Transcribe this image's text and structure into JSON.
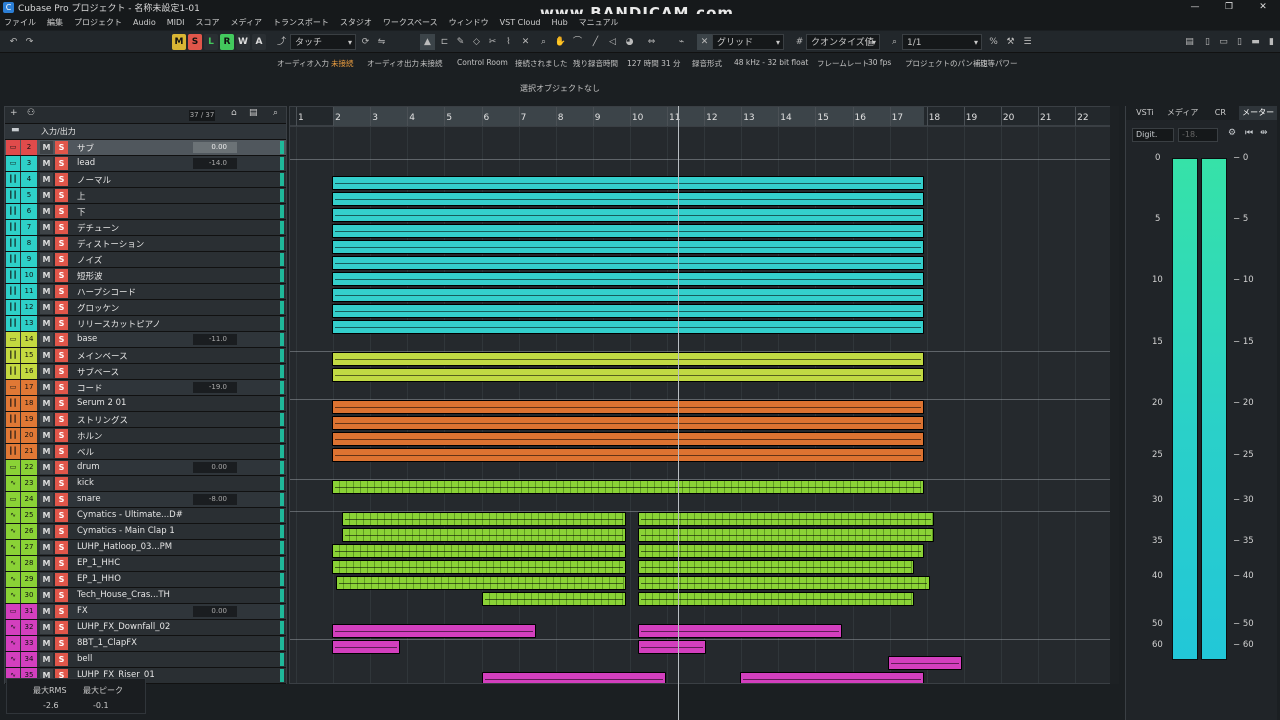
{
  "window": {
    "title": "Cubase Pro プロジェクト - 名称未設定1-01",
    "watermark": "www.BANDICAM.com",
    "controls": [
      "—",
      "❐",
      "✕"
    ]
  },
  "menu": [
    "ファイル",
    "編集",
    "プロジェクト",
    "Audio",
    "MIDI",
    "スコア",
    "メディア",
    "トランスポート",
    "スタジオ",
    "ワークスペース",
    "ウィンドウ",
    "VST Cloud",
    "Hub",
    "マニュアル"
  ],
  "toolbar": {
    "buttons": [
      "M",
      "S",
      "L",
      "R",
      "W",
      "A"
    ],
    "automation": "タッチ",
    "snap": "グリッド",
    "quantize": "クオンタイズ値",
    "grid": "1/1"
  },
  "status": {
    "input_label": "オーディオ入力",
    "input_value": "未接続",
    "output_label": "オーディオ出力",
    "output_value": "未接続",
    "control_room": "Control Room",
    "control_room_value": "接続されました",
    "rec_time_label": "残り録音時間",
    "rec_time_value": "127 時間 31 分",
    "rec_format_label": "録音形式",
    "rec_format_value": "48 kHz - 32 bit float",
    "frame_label": "フレームレート",
    "frame_value": "30 fps",
    "pan_label": "プロジェクトのパン補正",
    "pan_value": "均等パワー"
  },
  "info_line": "選択オブジェクトなし",
  "track_header": {
    "count": "37 / 37",
    "io_label": "入力/出力"
  },
  "ruler": [
    "1",
    "2",
    "3",
    "4",
    "5",
    "6",
    "7",
    "8",
    "9",
    "10",
    "11",
    "12",
    "13",
    "14",
    "15",
    "16",
    "17",
    "18",
    "19",
    "20",
    "21",
    "22"
  ],
  "tracks": [
    {
      "num": "2",
      "name": "サブ",
      "vol": "0.00",
      "type": "folder",
      "color": "#e04b4b",
      "icon": "folder-icon"
    },
    {
      "num": "3",
      "name": "lead",
      "vol": "-14.0",
      "type": "folder",
      "color": "#2ed0c8",
      "icon": "folder-icon"
    },
    {
      "num": "4",
      "name": "ノーマル",
      "vol": "",
      "type": "inst",
      "color": "#2ed0c8",
      "icon": "instrument-icon"
    },
    {
      "num": "5",
      "name": "上",
      "vol": "",
      "type": "inst",
      "color": "#2ed0c8",
      "icon": "instrument-icon"
    },
    {
      "num": "6",
      "name": "下",
      "vol": "",
      "type": "inst",
      "color": "#2ed0c8",
      "icon": "instrument-icon"
    },
    {
      "num": "7",
      "name": "デチューン",
      "vol": "",
      "type": "inst",
      "color": "#2ed0c8",
      "icon": "instrument-icon"
    },
    {
      "num": "8",
      "name": "ディストーション",
      "vol": "",
      "type": "inst",
      "color": "#2ed0c8",
      "icon": "instrument-icon"
    },
    {
      "num": "9",
      "name": "ノイズ",
      "vol": "",
      "type": "inst",
      "color": "#2ed0c8",
      "icon": "instrument-icon"
    },
    {
      "num": "10",
      "name": "短形波",
      "vol": "",
      "type": "inst",
      "color": "#2ed0c8",
      "icon": "instrument-icon"
    },
    {
      "num": "11",
      "name": "ハープシコード",
      "vol": "",
      "type": "inst",
      "color": "#2ed0c8",
      "icon": "instrument-icon"
    },
    {
      "num": "12",
      "name": "グロッケン",
      "vol": "",
      "type": "inst",
      "color": "#2ed0c8",
      "icon": "instrument-icon"
    },
    {
      "num": "13",
      "name": "リリースカットピアノ",
      "vol": "",
      "type": "inst",
      "color": "#2ed0c8",
      "icon": "instrument-icon"
    },
    {
      "num": "14",
      "name": "base",
      "vol": "-11.0",
      "type": "folder",
      "color": "#c4d940",
      "icon": "folder-icon"
    },
    {
      "num": "15",
      "name": "メインベース",
      "vol": "",
      "type": "inst",
      "color": "#c4d940",
      "icon": "instrument-icon"
    },
    {
      "num": "16",
      "name": "サブベース",
      "vol": "",
      "type": "inst",
      "color": "#c4d940",
      "icon": "instrument-icon"
    },
    {
      "num": "17",
      "name": "コード",
      "vol": "-19.0",
      "type": "folder",
      "color": "#e07835",
      "icon": "folder-icon"
    },
    {
      "num": "18",
      "name": "Serum 2 01",
      "vol": "",
      "type": "inst",
      "color": "#e07835",
      "icon": "instrument-icon"
    },
    {
      "num": "19",
      "name": "ストリングス",
      "vol": "",
      "type": "inst",
      "color": "#e07835",
      "icon": "instrument-icon"
    },
    {
      "num": "20",
      "name": "ホルン",
      "vol": "",
      "type": "inst",
      "color": "#e07835",
      "icon": "instrument-icon"
    },
    {
      "num": "21",
      "name": "ベル",
      "vol": "",
      "type": "inst",
      "color": "#e07835",
      "icon": "instrument-icon"
    },
    {
      "num": "22",
      "name": "drum",
      "vol": "0.00",
      "type": "folder",
      "color": "#8ad236",
      "icon": "folder-icon"
    },
    {
      "num": "23",
      "name": "kick",
      "vol": "",
      "type": "audio",
      "color": "#8ad236",
      "icon": "audio-icon"
    },
    {
      "num": "24",
      "name": "snare",
      "vol": "-8.00",
      "type": "folder",
      "color": "#8ad236",
      "icon": "folder-icon"
    },
    {
      "num": "25",
      "name": "Cymatics - Ultimate...D#",
      "vol": "",
      "type": "audio",
      "color": "#8ad236",
      "icon": "audio-icon"
    },
    {
      "num": "26",
      "name": "Cymatics - Main Clap 1",
      "vol": "",
      "type": "audio",
      "color": "#8ad236",
      "icon": "audio-icon"
    },
    {
      "num": "27",
      "name": "LUHP_Hatloop_03...PM",
      "vol": "",
      "type": "audio",
      "color": "#8ad236",
      "icon": "audio-icon"
    },
    {
      "num": "28",
      "name": "EP_1_HHC",
      "vol": "",
      "type": "audio",
      "color": "#8ad236",
      "icon": "audio-icon"
    },
    {
      "num": "29",
      "name": "EP_1_HHO",
      "vol": "",
      "type": "audio",
      "color": "#8ad236",
      "icon": "audio-icon"
    },
    {
      "num": "30",
      "name": "Tech_House_Cras...TH",
      "vol": "",
      "type": "audio",
      "color": "#8ad236",
      "icon": "audio-icon"
    },
    {
      "num": "31",
      "name": "FX",
      "vol": "0.00",
      "type": "folder",
      "color": "#d33fbe",
      "icon": "folder-icon"
    },
    {
      "num": "32",
      "name": "LUHP_FX_Downfall_02",
      "vol": "",
      "type": "audio",
      "color": "#d33fbe",
      "icon": "audio-icon"
    },
    {
      "num": "33",
      "name": "8BT_1_ClapFX",
      "vol": "",
      "type": "audio",
      "color": "#d33fbe",
      "icon": "audio-icon"
    },
    {
      "num": "34",
      "name": "bell",
      "vol": "",
      "type": "audio",
      "color": "#d33fbe",
      "icon": "audio-icon"
    },
    {
      "num": "35",
      "name": "LUHP_FX_Riser_01",
      "vol": "",
      "type": "audio",
      "color": "#d33fbe",
      "icon": "audio-icon"
    }
  ],
  "right_panel": {
    "tabs": [
      "VSTi",
      "メディア",
      "CR",
      "メーター"
    ],
    "display_mode": "Digit.",
    "peak_hold": "-18.",
    "scale": [
      "0",
      "5",
      "10",
      "15",
      "20",
      "25",
      "30",
      "35",
      "40",
      "50",
      "60"
    ],
    "rms_label": "最大RMS",
    "peak_label": "最大ピーク",
    "rms_value": "-2.6",
    "peak_value": "-0.1"
  }
}
